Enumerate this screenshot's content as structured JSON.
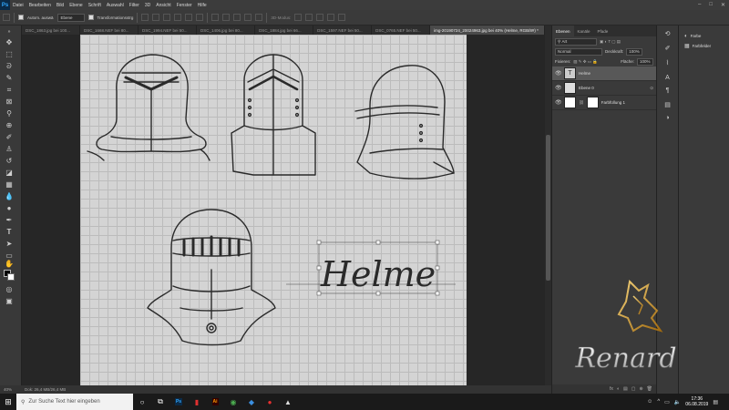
{
  "app": {
    "logo": "Ps",
    "menu": [
      "Datei",
      "Bearbeiten",
      "Bild",
      "Ebene",
      "Schrift",
      "Auswahl",
      "Filter",
      "3D",
      "Ansicht",
      "Fenster",
      "Hilfe"
    ],
    "window_controls": [
      "–",
      "□",
      "✕"
    ]
  },
  "options_bar": {
    "auto_select_label": "Autom. auswä",
    "auto_select_target": "Ebene",
    "transform_label": "Transformationsstrg",
    "mode_3d": "3D-Modus:"
  },
  "tabs": [
    {
      "label": "DSC_1863.jpg bei 100...",
      "active": false
    },
    {
      "label": "DSC_1668.NEF bei 80...",
      "active": false
    },
    {
      "label": "DSC_1994.NEF bei 50...",
      "active": false
    },
    {
      "label": "DSC_1406.jpg bei 80...",
      "active": false
    },
    {
      "label": "DSC_1884.jpg bei 66...",
      "active": false
    },
    {
      "label": "DSC_1597.NEF bei 50...",
      "active": false
    },
    {
      "label": "DSC_0765.NEF bei 50...",
      "active": false
    },
    {
      "label": "img-20190724_20024963.jpg bei 40% (Helme, RGB/8#) *",
      "active": true
    }
  ],
  "canvas": {
    "lettering": "Helme"
  },
  "status": {
    "zoom": "40%",
    "doc_size": "Dok: 26,4 MB/26,4 MB"
  },
  "layers_panel": {
    "tabs": [
      "Ebenen",
      "Kanäle",
      "Pfade"
    ],
    "filter_label": "Art",
    "blend_mode": "Normal",
    "opacity_label": "Deckkraft:",
    "opacity_value": "100%",
    "lock_label": "Fixieren:",
    "fill_label": "Fläche:",
    "fill_value": "100%",
    "layers": [
      {
        "name": "Helme",
        "thumb": "T",
        "selected": true
      },
      {
        "name": "Ebene 0",
        "thumb": "",
        "selected": false
      },
      {
        "name": "Farbfüllung 1",
        "thumb": "",
        "selected": false
      }
    ],
    "footer_icons": [
      "fx",
      "◐",
      "▤",
      "▢",
      "⊕",
      "🗑"
    ]
  },
  "props_panel": {
    "items": [
      {
        "label": "Farbe",
        "icon": "palette-icon"
      },
      {
        "label": "Farbfelder",
        "icon": "swatches-icon"
      }
    ]
  },
  "watermark": {
    "text": "Renard"
  },
  "taskbar": {
    "search_placeholder": "Zur Suche Text hier eingeben",
    "time": "17:36",
    "date": "06.08.2019"
  }
}
